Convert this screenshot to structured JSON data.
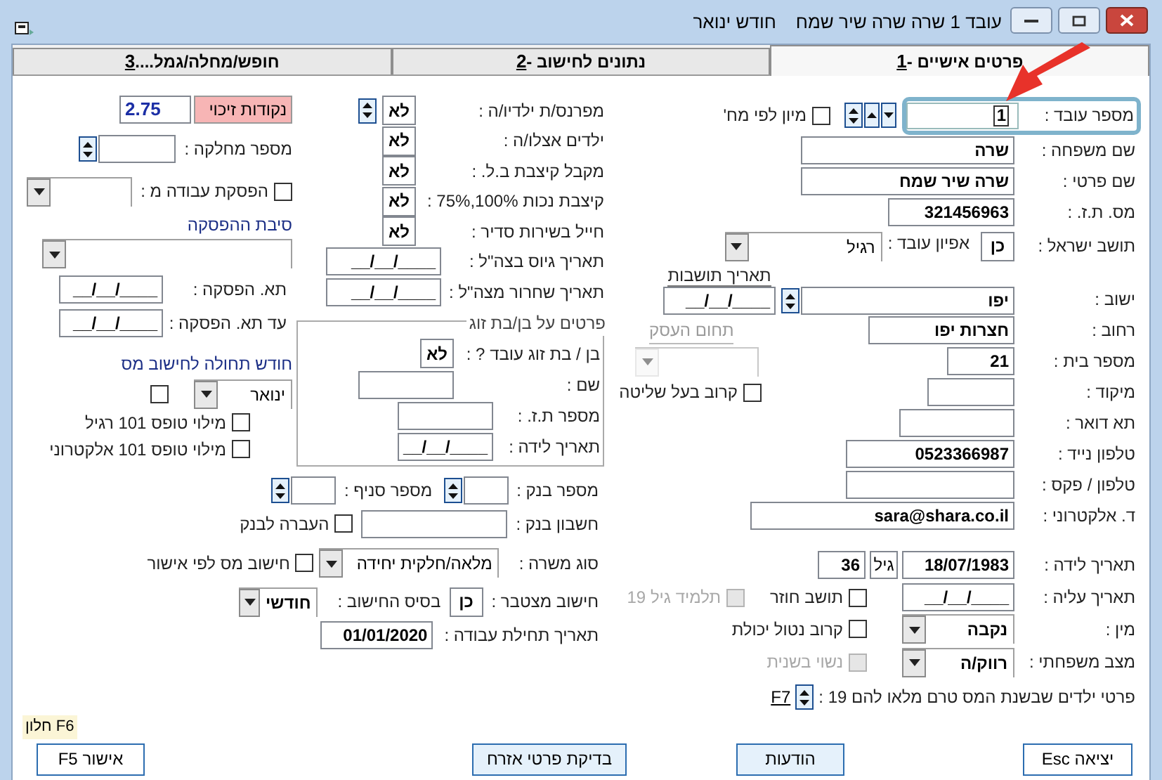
{
  "window": {
    "title": "עובד 1 שרה שרה שיר שמח",
    "subtitle": "חודש ינואר"
  },
  "tabs": [
    {
      "label": "פרטים אישיים - ",
      "hotkey": "1",
      "selected": true
    },
    {
      "label": "נתונים לחישוב - ",
      "hotkey": "2",
      "selected": false
    },
    {
      "label": "חופש/מחלה/גמל.... ",
      "hotkey": "3",
      "selected": false
    }
  ],
  "personal": {
    "number": {
      "label": "מספר עובד :",
      "value": "1"
    },
    "sort_by_department": {
      "label": "מיון לפי מח'",
      "checked": false
    },
    "last_name": {
      "label": "שם משפחה :",
      "value": "שרה"
    },
    "first_name": {
      "label": "שם פרטי :",
      "value": "שרה שיר שמח"
    },
    "id": {
      "label": "מס. ת.ז. :",
      "value": "321456963"
    },
    "resident": {
      "label": "תושב ישראל :",
      "value": "כן"
    },
    "employee_type": {
      "label": "אפיון עובד :",
      "value": "רגיל"
    },
    "city": {
      "label": "ישוב :",
      "value": "יפו"
    },
    "residence_date": {
      "label": "תאריך תושבות",
      "value": "__/__/____"
    },
    "street": {
      "label": "רחוב :",
      "value": "חצרות יפו"
    },
    "business_field": {
      "label": "תחום העסק",
      "disabled": true
    },
    "house": {
      "label": "מספר בית :",
      "value": "21"
    },
    "zip": {
      "label": "מיקוד :"
    },
    "controlling_relative": {
      "label": "קרוב בעל שליטה",
      "checked": false
    },
    "po_box": {
      "label": "תא דואר :"
    },
    "mobile": {
      "label": "טלפון נייד :",
      "value": "0523366987"
    },
    "phone": {
      "label": "טלפון / פקס :"
    },
    "email": {
      "label": "ד. אלקטרוני :",
      "value": "sara@shara.co.il"
    },
    "birth_date": {
      "label": "תאריך לידה :",
      "value": "18/07/1983"
    },
    "age": {
      "label": "גיל",
      "value": "36"
    },
    "aliya_date": {
      "label": "תאריך עליה :",
      "value": "__/__/____"
    },
    "returning_resident": {
      "label": "תושב חוזר",
      "checked": false,
      "disabled": false
    },
    "student_19": {
      "label": "תלמיד גיל 19",
      "checked": false,
      "disabled": true
    },
    "gender": {
      "label": "מין :",
      "value": "נקבה"
    },
    "disabled_relative": {
      "label": "קרוב נטול יכולת",
      "checked": false,
      "disabled": false
    },
    "marital": {
      "label": "מצב משפחתי :",
      "value": "רווק/ה"
    },
    "remarried": {
      "label": "נשוי בשנית",
      "checked": false,
      "disabled": true
    },
    "children_note": {
      "label": "פרטי ילדים שבשנת המס טרם מלאו להם 19 :",
      "hotkey": "F7"
    }
  },
  "family": {
    "rows": [
      {
        "label": "מפרנס/ת ילדיו/ה :",
        "value": "לא",
        "spinner": true
      },
      {
        "label": "ילדים אצלו/ה :",
        "value": "לא",
        "spinner": false
      },
      {
        "label": "מקבל קיצבת ב.ל. :",
        "value": "לא",
        "spinner": false
      },
      {
        "label": "קיצבת נכות 100%,75% :",
        "value": "לא",
        "spinner": false
      },
      {
        "label": "חייל בשירות סדיר :",
        "value": "לא",
        "spinner": false
      }
    ],
    "enlist_date": {
      "label": "תאריך גיוס בצה\"ל :",
      "value": "__/__/____"
    },
    "discharge_date": {
      "label": "תאריך שחרור מצה\"ל :",
      "value": "__/__/____"
    }
  },
  "spouse": {
    "title": "פרטים על בן/בת זוג",
    "works": {
      "label": "בן / בת זוג עובד ? :",
      "value": "לא"
    },
    "name": {
      "label": "שם :"
    },
    "id": {
      "label": "מספר ת.ז. :"
    },
    "birth_date": {
      "label": "תאריך לידה :",
      "value": "__/__/____"
    }
  },
  "tax": {
    "credit_points": {
      "label": "נקודות זיכוי",
      "value": "2.75"
    },
    "department": {
      "label": "מספר מחלקה :"
    },
    "stop_work": {
      "label": "הפסקת עבודה מ :",
      "checked": false
    },
    "stop_reason": {
      "label": "סיבת ההפסקה"
    },
    "stop_date": {
      "label": "תא. הפסקה :",
      "value": "__/__/____"
    },
    "stop_until": {
      "label": "עד תא. הפסקה :",
      "value": "__/__/____"
    },
    "tax_month": {
      "label": "חודש תחולה לחישוב מס",
      "value": "ינואר",
      "checked": false
    },
    "form101": [
      {
        "label": "מילוי טופס 101 רגיל",
        "checked": false
      },
      {
        "label": "מילוי טופס 101 אלקטרוני",
        "checked": false
      }
    ]
  },
  "bank": {
    "bank": {
      "label": "מספר בנק :"
    },
    "branch": {
      "label": "מספר סניף :"
    },
    "account": {
      "label": "חשבון בנק :"
    },
    "transfer": {
      "label": "העברה לבנק",
      "checked": false
    }
  },
  "employment": {
    "job_type": {
      "label": "סוג משרה :",
      "value": "מלאה/חלקית יחידה"
    },
    "tax_by_approval": {
      "label": "חישוב מס לפי אישור",
      "checked": false
    },
    "cumulative": {
      "label": "חישוב מצטבר :",
      "value": "כן"
    },
    "basis": {
      "label": "בסיס החישוב :",
      "value": "חודשי"
    },
    "start_date": {
      "label": "תאריך תחילת עבודה :",
      "value": "01/01/2020"
    }
  },
  "hint": "F6 חלון",
  "buttons": [
    {
      "label": "יציאה Esc"
    },
    {
      "label": "הודעות"
    },
    {
      "label": "בדיקת פרטי אזרח"
    },
    {
      "label": "אישור F5"
    }
  ]
}
